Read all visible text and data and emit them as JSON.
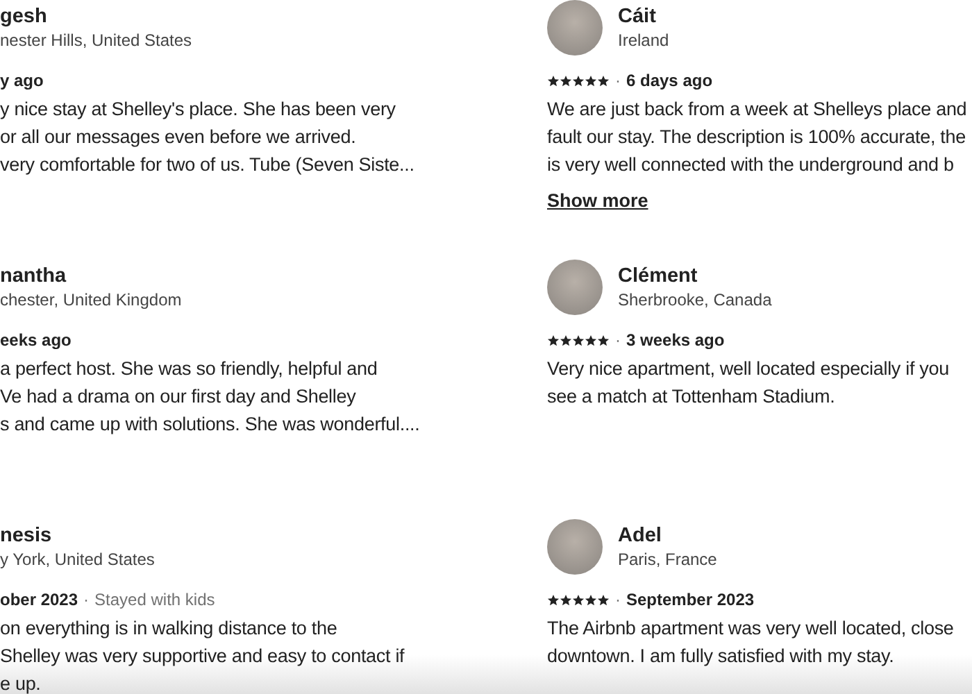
{
  "reviews": [
    {
      "avatar": false,
      "name": "gesh",
      "location": "nester Hills, United States",
      "date": "y ago",
      "text_lines": [
        "y nice stay at Shelley's place. She has been very",
        "or all our messages even before we arrived.",
        "very comfortable for two of us. Tube (Seven Siste..."
      ]
    },
    {
      "avatar": true,
      "name": "Cáit",
      "location": "Ireland",
      "stars": 5,
      "separator": "·",
      "date": "6 days ago",
      "text_lines": [
        "We are just back from a week at Shelleys place and",
        "fault our stay. The description is 100% accurate, the",
        "is very well connected with the underground and b"
      ],
      "show_more": "Show more"
    },
    {
      "avatar": false,
      "name": "nantha",
      "location": "chester, United Kingdom",
      "date": "eeks ago",
      "text_lines": [
        "a perfect host. She was so friendly, helpful and",
        "Ve had a drama on our first day and Shelley",
        "s and came up with solutions. She was wonderful...."
      ]
    },
    {
      "avatar": true,
      "name": "Clément",
      "location": "Sherbrooke, Canada",
      "stars": 5,
      "separator": "·",
      "date": "3 weeks ago",
      "text_lines": [
        "Very nice apartment, well located especially if you",
        "see a match at Tottenham Stadium."
      ]
    },
    {
      "avatar": false,
      "name": "nesis",
      "location": "y York, United States",
      "date": "ober 2023",
      "separator": "·",
      "trip": "Stayed with kids",
      "text_lines": [
        "on everything is in walking distance to the",
        "Shelley was very supportive and easy to contact if",
        "e up."
      ]
    },
    {
      "avatar": true,
      "name": "Adel",
      "location": "Paris, France",
      "stars": 5,
      "separator": "·",
      "date": "September 2023",
      "text_lines": [
        "The Airbnb apartment was very well located, close",
        "downtown. I am fully satisfied with my stay."
      ]
    }
  ]
}
